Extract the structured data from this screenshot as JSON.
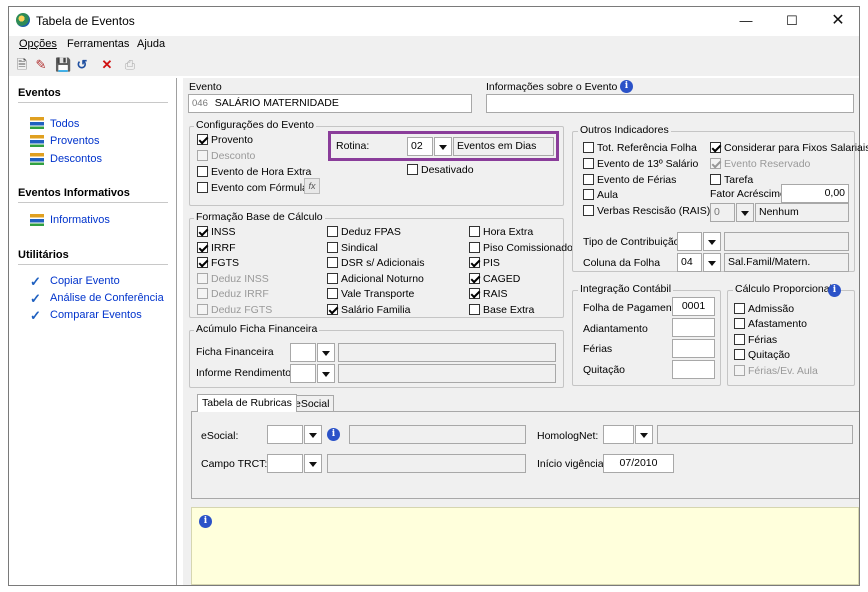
{
  "title": "Tabela de Eventos",
  "menu": [
    "Opções",
    "Ferramentas",
    "Ajuda"
  ],
  "sidebar": {
    "h1": "Eventos",
    "items1": [
      "Todos",
      "Proventos",
      "Descontos"
    ],
    "h2": "Eventos Informativos",
    "items2": [
      "Informativos"
    ],
    "h3": "Utilitários",
    "items3": [
      "Copiar Evento",
      "Análise de Conferência",
      "Comparar Eventos"
    ]
  },
  "evento": {
    "label": "Evento",
    "code": "046",
    "name": "SALÁRIO MATERNIDADE",
    "info_label": "Informações sobre o Evento"
  },
  "config": {
    "title": "Configurações do Evento",
    "provento": "Provento",
    "desconto": "Desconto",
    "hora_extra": "Evento de Hora Extra",
    "formula": "Evento com Fórmula",
    "fx": "fx",
    "rotina_label": "Rotina:",
    "rotina_code": "02",
    "rotina_value": "Eventos em Dias",
    "desativado": "Desativado"
  },
  "base": {
    "title": "Formação Base de Cálculo",
    "c1": [
      "INSS",
      "IRRF",
      "FGTS",
      "Deduz INSS",
      "Deduz IRRF",
      "Deduz FGTS"
    ],
    "c2": [
      "Deduz FPAS",
      "Sindical",
      "DSR s/ Adicionais",
      "Adicional Noturno",
      "Vale Transporte",
      "Salário Familia"
    ],
    "c3": [
      "Hora Extra",
      "Piso Comissionado",
      "PIS",
      "CAGED",
      "RAIS",
      "Base Extra"
    ]
  },
  "acumulo": {
    "title": "Acúmulo Ficha Financeira",
    "ficha": "Ficha Financeira",
    "informe": "Informe Rendimentos"
  },
  "outros": {
    "title": "Outros Indicadores",
    "tot": "Tot. Referência Folha",
    "e13": "Evento de 13º Salário",
    "ferias": "Evento de Férias",
    "aula": "Aula",
    "verbas": "Verbas Rescisão (RAIS)",
    "considerar": "Considerar para Fixos Salariais",
    "reservado": "Evento Reservado",
    "tarefa": "Tarefa",
    "fator_label": "Fator Acréscimo",
    "fator_value": "0,00",
    "verbas_code": "0",
    "verbas_value": "Nenhum",
    "tipo_label": "Tipo de Contribuição",
    "coluna_label": "Coluna da Folha",
    "coluna_code": "04",
    "coluna_value": "Sal.Famil/Matern."
  },
  "integracao": {
    "title": "Integração Contábil",
    "folha": "Folha de Pagamento",
    "folha_value": "0001",
    "adiantamento": "Adiantamento",
    "ferias": "Férias",
    "quitacao": "Quitação"
  },
  "calculo": {
    "title": "Cálculo Proporcional",
    "items": [
      "Admissão",
      "Afastamento",
      "Férias",
      "Quitação",
      "Férias/Ev. Aula"
    ]
  },
  "tabs": {
    "t1": "Tabela de Rubricas",
    "t2": "eSocial"
  },
  "rubricas": {
    "esocial": "eSocial:",
    "homolog": "HomologNet:",
    "trct": "Campo TRCT:",
    "inicio": "Início vigência:",
    "inicio_value": "07/2010"
  }
}
